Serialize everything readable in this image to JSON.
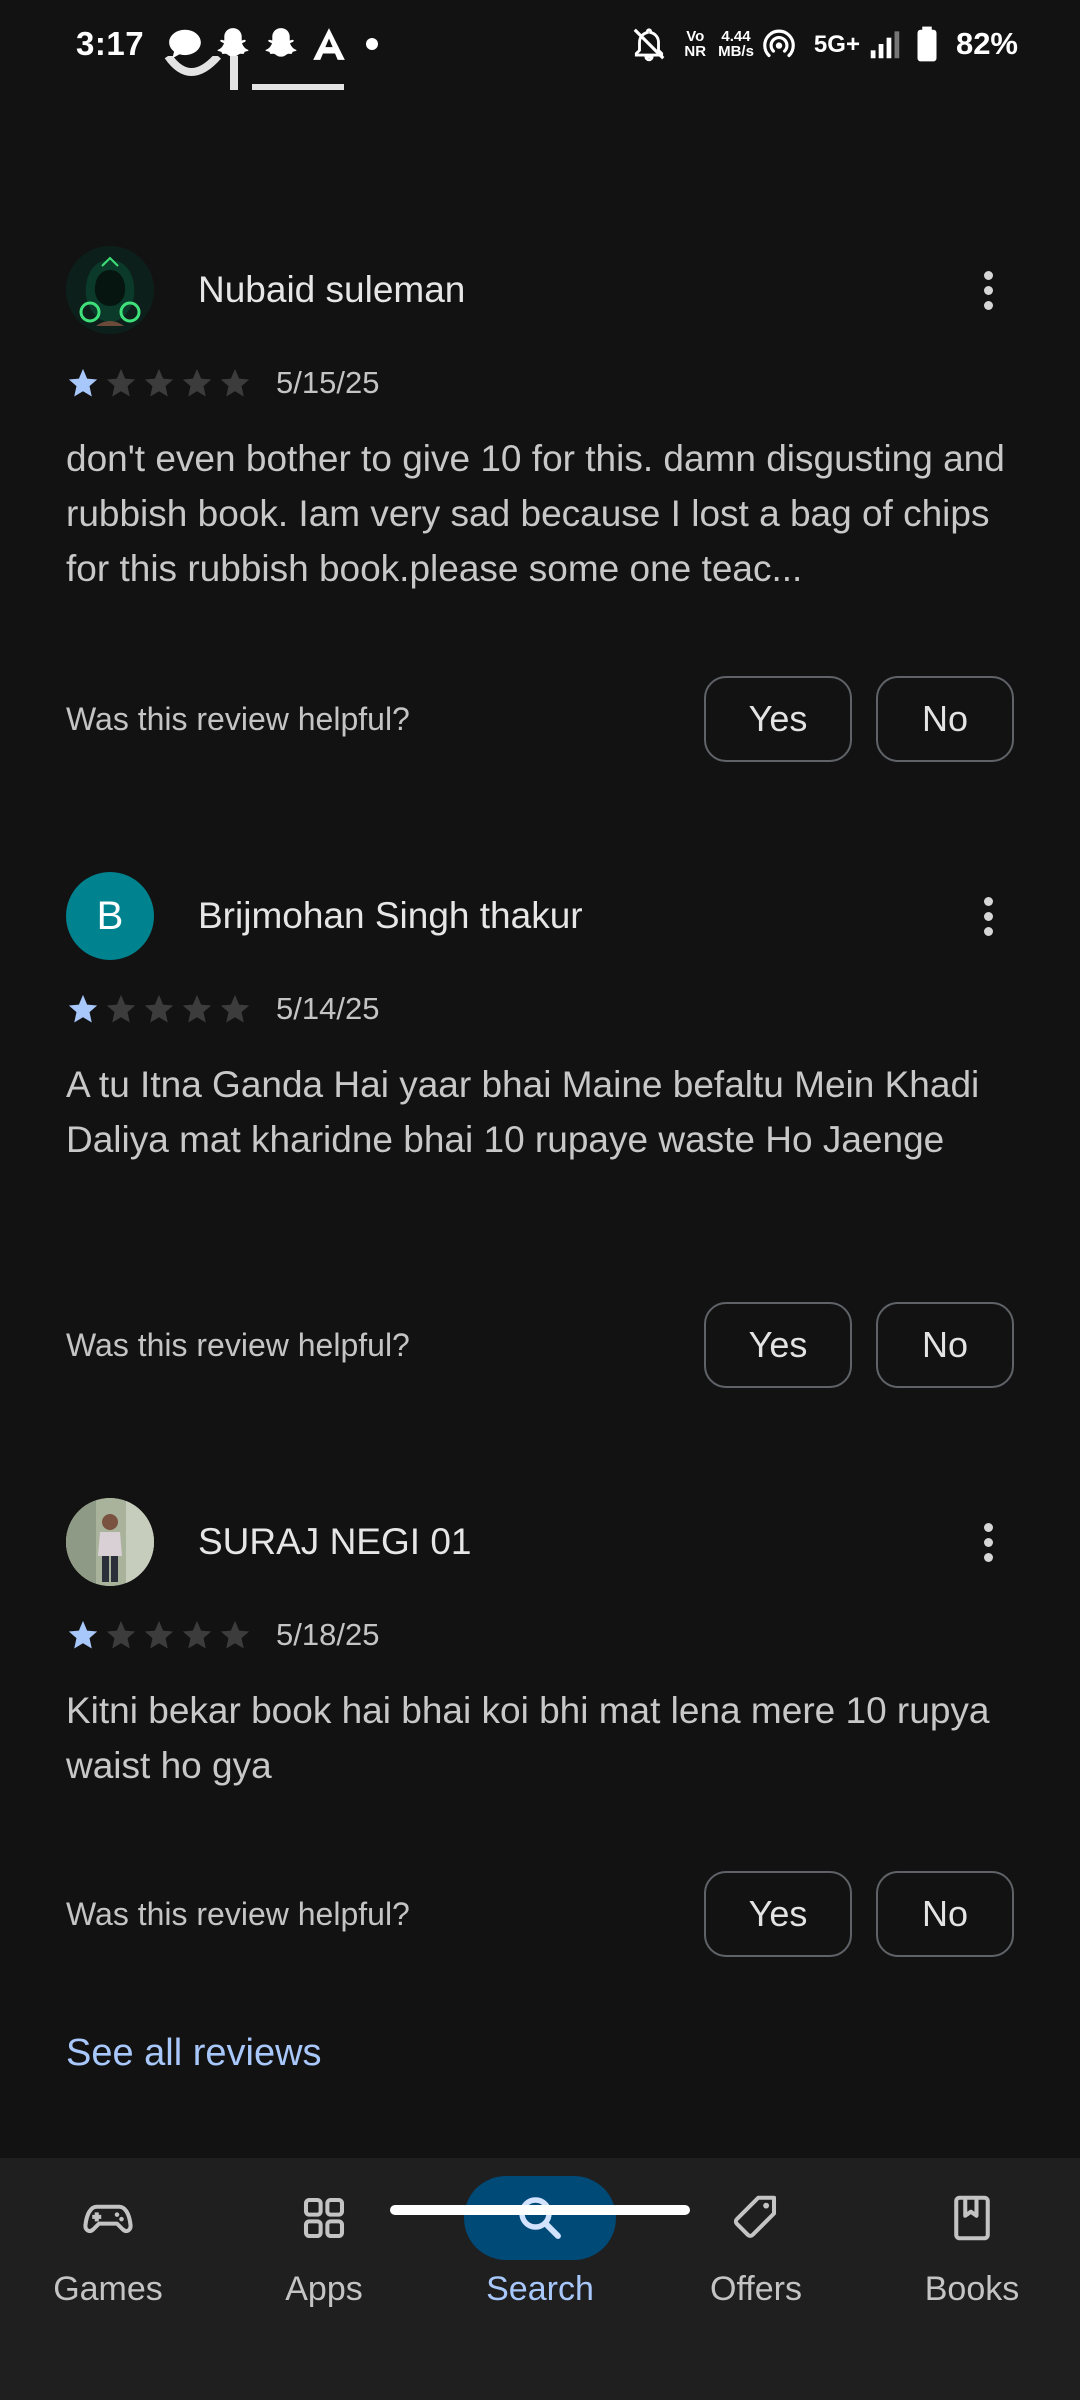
{
  "status_bar": {
    "time": "3:17",
    "network_speed_value": "4.44",
    "network_speed_unit": "MB/s",
    "vo_label": "Vo",
    "nr_label": "NR",
    "network_type": "5G+",
    "battery": "82%",
    "icons": [
      "chat-bubble-icon",
      "snapchat-icon",
      "snapchat-icon",
      "app-a-icon",
      "notification-dot",
      "bell-muted-icon",
      "hotspot-icon",
      "signal-icon",
      "battery-icon"
    ]
  },
  "reviews": [
    {
      "name": "Nubaid suleman",
      "avatar": {
        "type": "image",
        "icon": "hooded-figure-avatar"
      },
      "rating": 1,
      "max_rating": 5,
      "date": "5/15/25",
      "text": "don't even bother to give 10 for this. damn disgusting and rubbish book. Iam very sad because I lost a bag of chips for this rubbish book.please some one teac...",
      "helpful_question": "Was this review helpful?",
      "yes_label": "Yes",
      "no_label": "No"
    },
    {
      "name": "Brijmohan Singh thakur",
      "avatar": {
        "type": "letter",
        "letter": "B",
        "color": "#00838f"
      },
      "rating": 1,
      "max_rating": 5,
      "date": "5/14/25",
      "text": "A tu Itna Ganda Hai yaar bhai Maine befaltu Mein Khadi Daliya mat kharidne bhai 10 rupaye waste Ho Jaenge",
      "helpful_question": "Was this review helpful?",
      "yes_label": "Yes",
      "no_label": "No"
    },
    {
      "name": "SURAJ NEGI 01",
      "avatar": {
        "type": "image",
        "icon": "person-photo-avatar"
      },
      "rating": 1,
      "max_rating": 5,
      "date": "5/18/25",
      "text": "Kitni bekar book hai bhai koi bhi mat lena mere 10 rupya waist ho gya",
      "helpful_question": "Was this review helpful?",
      "yes_label": "Yes",
      "no_label": "No"
    }
  ],
  "see_all_reviews": "See all reviews",
  "bottom_nav": {
    "items": [
      {
        "label": "Games",
        "icon": "gamepad-icon",
        "active": false
      },
      {
        "label": "Apps",
        "icon": "apps-grid-icon",
        "active": false
      },
      {
        "label": "Search",
        "icon": "search-icon",
        "active": true
      },
      {
        "label": "Offers",
        "icon": "tag-icon",
        "active": false
      },
      {
        "label": "Books",
        "icon": "bookmark-book-icon",
        "active": false
      }
    ]
  },
  "colors": {
    "background": "#121212",
    "nav_background": "#1f1f1f",
    "accent": "#a8c7fa",
    "active_pill": "#004a77",
    "star_filled": "#a8c7fa",
    "star_empty": "#3c3c3c"
  }
}
